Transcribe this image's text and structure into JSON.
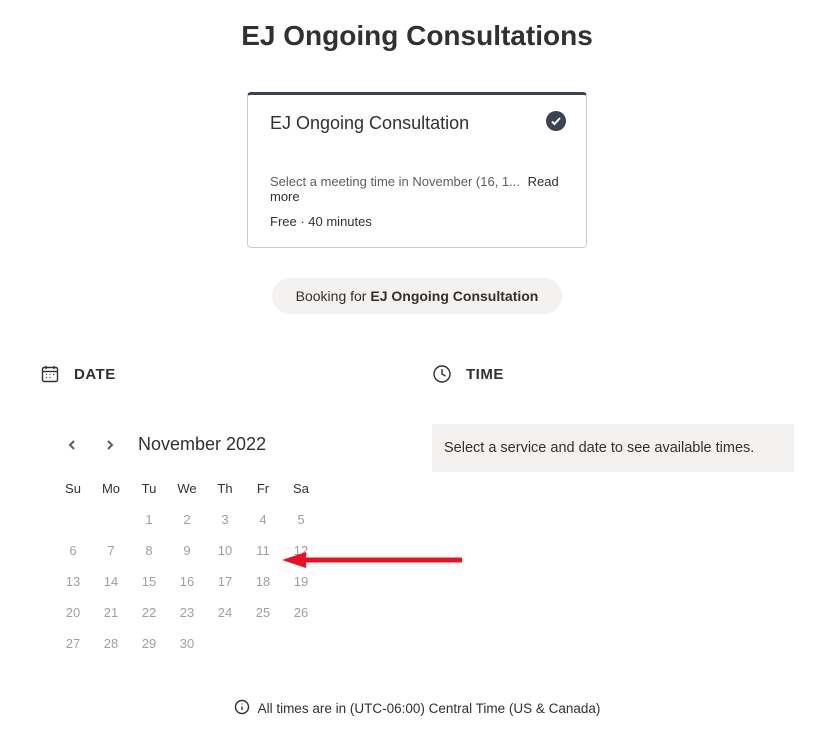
{
  "page_title": "EJ Ongoing Consultations",
  "card": {
    "title": "EJ Ongoing Consultation",
    "description": "Select a meeting time in November (16, 1...",
    "read_more": "Read more",
    "meta": "Free · 40 minutes"
  },
  "booking": {
    "prefix": "Booking for ",
    "service": "EJ Ongoing Consultation"
  },
  "date_section": {
    "label": "DATE"
  },
  "time_section": {
    "label": "TIME",
    "placeholder": "Select a service and date to see available times."
  },
  "calendar": {
    "month_label": "November 2022",
    "weekdays": [
      "Su",
      "Mo",
      "Tu",
      "We",
      "Th",
      "Fr",
      "Sa"
    ],
    "leading_blanks": 2,
    "days": [
      "1",
      "2",
      "3",
      "4",
      "5",
      "6",
      "7",
      "8",
      "9",
      "10",
      "11",
      "12",
      "13",
      "14",
      "15",
      "16",
      "17",
      "18",
      "19",
      "20",
      "21",
      "22",
      "23",
      "24",
      "25",
      "26",
      "27",
      "28",
      "29",
      "30"
    ]
  },
  "timezone_note": "All times are in (UTC-06:00) Central Time (US & Canada)"
}
